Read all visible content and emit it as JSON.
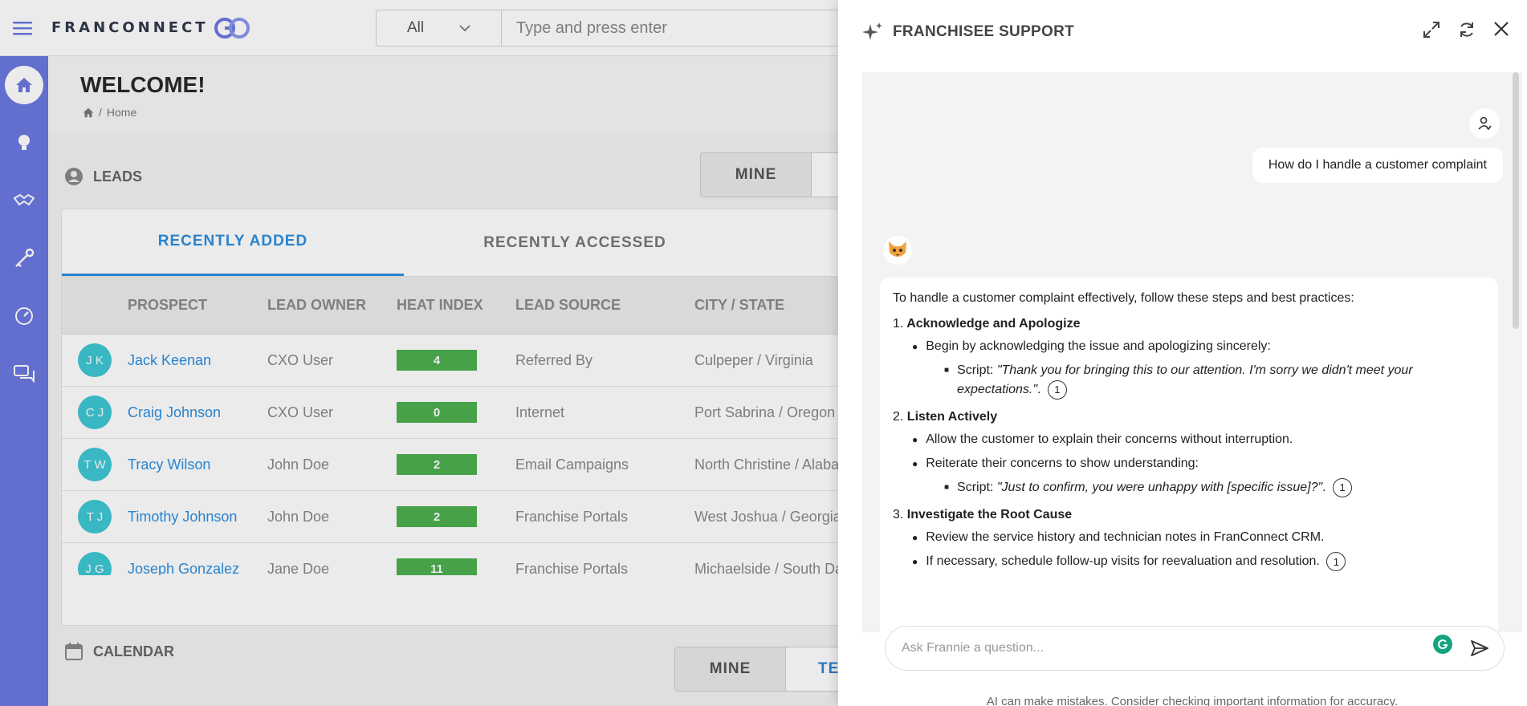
{
  "brand": {
    "name": "FRANCONNECT",
    "accent": "#6b79e0",
    "link": "#2d8fe0"
  },
  "search": {
    "scope": "All",
    "placeholder": "Type and press enter"
  },
  "rail": {
    "items": [
      "home-icon",
      "lightbulb-icon",
      "handshake-icon",
      "key-icon",
      "gauge-icon",
      "chat-icon"
    ]
  },
  "page": {
    "title": "WELCOME!",
    "breadcrumb": "Home"
  },
  "leads": {
    "title": "LEADS",
    "filter": [
      "MINE"
    ],
    "tabs": [
      "RECENTLY ADDED",
      "RECENTLY ACCESSED"
    ],
    "columns": [
      "PROSPECT",
      "LEAD OWNER",
      "HEAT INDEX",
      "LEAD SOURCE",
      "CITY / STATE"
    ],
    "rows": [
      {
        "initials": "J K",
        "name": "Jack Keenan",
        "owner": "CXO User",
        "heat": "4",
        "source": "Referred By",
        "city": "Culpeper / Virginia"
      },
      {
        "initials": "C J",
        "name": "Craig Johnson",
        "owner": "CXO User",
        "heat": "0",
        "source": "Internet",
        "city": "Port Sabrina / Oregon"
      },
      {
        "initials": "T W",
        "name": "Tracy Wilson",
        "owner": "John Doe",
        "heat": "2",
        "source": "Email Campaigns",
        "city": "North Christine / Alabar"
      },
      {
        "initials": "T J",
        "name": "Timothy Johnson",
        "owner": "John Doe",
        "heat": "2",
        "source": "Franchise Portals",
        "city": "West Joshua / Georgia"
      },
      {
        "initials": "J G",
        "name": "Joseph Gonzalez",
        "owner": "Jane Doe",
        "heat": "11",
        "source": "Franchise Portals",
        "city": "Michaelside / South Dal"
      }
    ]
  },
  "calendar": {
    "title": "CALENDAR",
    "filter": [
      "MINE",
      "TE"
    ]
  },
  "support": {
    "title": "FRANCHISEE SUPPORT",
    "user_message": "How do I handle a customer complaint",
    "answer": {
      "intro": "To handle a customer complaint effectively, follow these steps and best practices:",
      "steps": [
        {
          "num": "1.",
          "title": "Acknowledge and Apologize"
        },
        {
          "num": "2.",
          "title": "Listen Actively"
        },
        {
          "num": "3.",
          "title": "Investigate the Root Cause"
        }
      ],
      "s1_b1": "Begin by acknowledging the issue and apologizing sincerely:",
      "s1_script_label": "Script: ",
      "s1_script": "\"Thank you for bringing this to our attention. I'm sorry we didn't meet your expectations.\"",
      "s2_b1": "Allow the customer to explain their concerns without interruption.",
      "s2_b2": "Reiterate their concerns to show understanding:",
      "s2_script_label": "Script: ",
      "s2_script": "\"Just to confirm, you were unhappy with [specific issue]?\"",
      "s3_b1": "Review the service history and technician notes in FranConnect CRM.",
      "s3_b2": "If necessary, schedule follow-up visits for reevaluation and resolution.",
      "cite": "1"
    },
    "composer_placeholder": "Ask Frannie a question...",
    "disclaimer": "AI can make mistakes. Consider checking important information for accuracy."
  }
}
